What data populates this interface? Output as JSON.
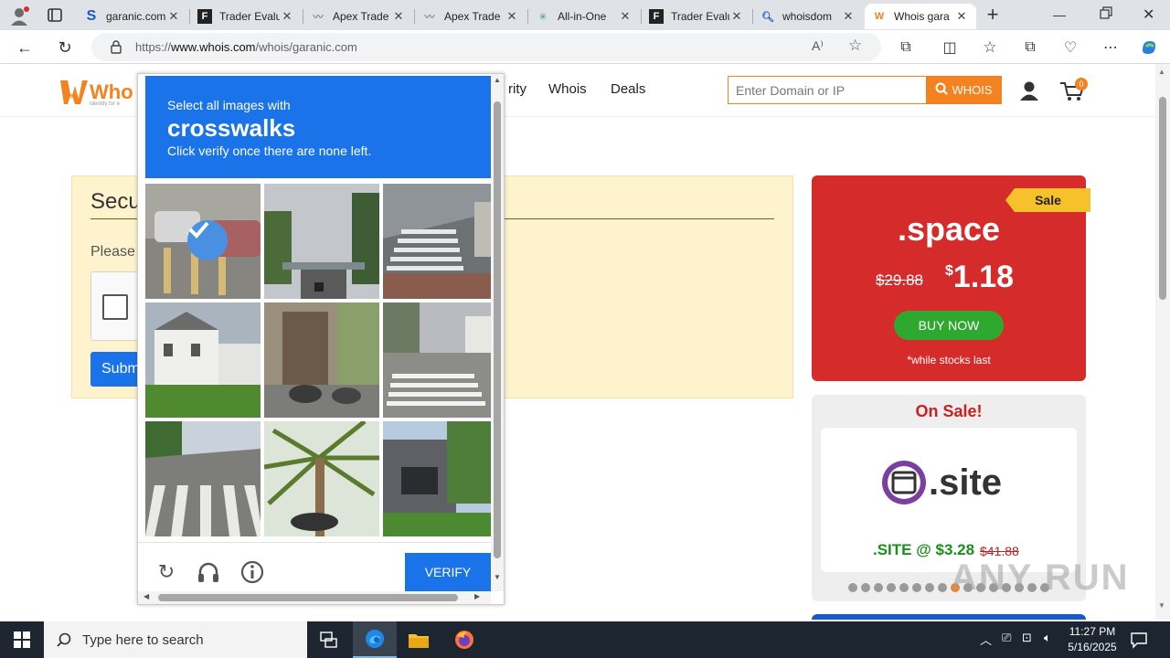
{
  "browser": {
    "tabs": [
      {
        "label": "garanic.com",
        "icon": "s-logo-icon"
      },
      {
        "label": "Trader Evalu",
        "icon": "ftmo-icon"
      },
      {
        "label": "Apex Trade",
        "icon": "apex-icon"
      },
      {
        "label": "Apex Trade",
        "icon": "apex-icon"
      },
      {
        "label": "All-in-One",
        "icon": "spark-icon"
      },
      {
        "label": "Trader Evalu",
        "icon": "ftmo-icon"
      },
      {
        "label": "whoisdom",
        "icon": "search-icon"
      },
      {
        "label": "Whois gara",
        "icon": "whois-icon",
        "active": true
      }
    ],
    "url_prefix": "https://",
    "url_host": "www.whois.com",
    "url_path": "/whois/garanic.com"
  },
  "site": {
    "nav": [
      "rity",
      "Whois",
      "Deals"
    ],
    "search_placeholder": "Enter Domain or IP",
    "search_button": "WHOIS",
    "cart_count": "0",
    "secure_title": "Secu",
    "secure_text": "Please",
    "submit_label": "Subm"
  },
  "promo_space": {
    "badge": "Sale",
    "title": ".space",
    "old_price": "$29.88",
    "currency": "$",
    "new_price": "1.18",
    "button": "BUY NOW",
    "note": "*while stocks last"
  },
  "promo_site": {
    "heading": "On Sale!",
    "brand": ".site",
    "offer": ".SITE @ $3.28",
    "old_price": "$41.88",
    "dots": 16,
    "active_dot": 8
  },
  "captcha": {
    "prompt": "Select all images with",
    "target": "crosswalks",
    "instruction": "Click verify once there are none left.",
    "verify_label": "VERIFY",
    "selected_tiles": [
      0
    ]
  },
  "taskbar": {
    "search_placeholder": "Type here to search",
    "time": "11:27 PM",
    "date": "5/16/2025"
  },
  "watermark": "ANY RUN"
}
